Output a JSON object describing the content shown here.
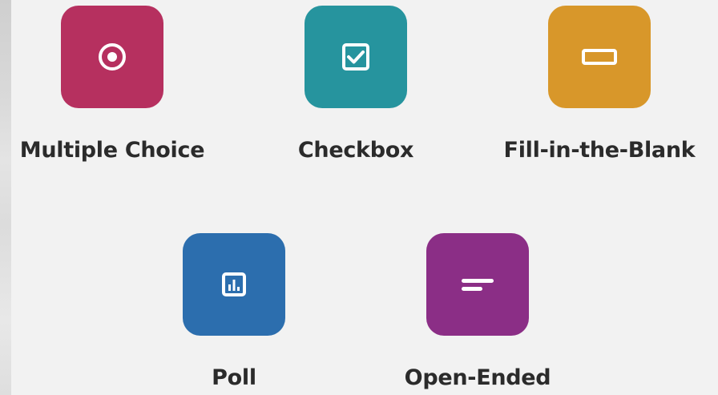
{
  "question_types": [
    {
      "label": "Multiple Choice",
      "icon": "radio-icon",
      "color": "#B6305F"
    },
    {
      "label": "Checkbox",
      "icon": "checkbox-icon",
      "color": "#26949E"
    },
    {
      "label": "Fill-in-the-Blank",
      "icon": "blank-field-icon",
      "color": "#D8972A"
    },
    {
      "label": "Poll",
      "icon": "poll-chart-icon",
      "color": "#2C6EAE"
    },
    {
      "label": "Open-Ended",
      "icon": "text-lines-icon",
      "color": "#8B2E86"
    }
  ]
}
